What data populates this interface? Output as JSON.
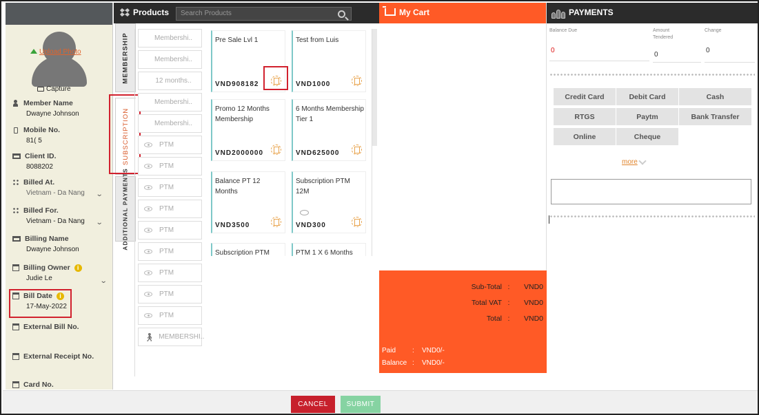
{
  "member": {
    "upload_photo": "Upload Photo",
    "capture": "Capture",
    "member_name_label": "Member Name",
    "member_name": "Dwayne Johnson",
    "mobile_label": "Mobile No.",
    "mobile": "81( 5",
    "client_id_label": "Client ID.",
    "client_id": "8088202",
    "billed_at_label": "Billed At.",
    "billed_at": "Vietnam - Da Nang",
    "billed_for_label": "Billed For.",
    "billed_for": "Vietnam - Da Nang",
    "billing_name_label": "Billing Name",
    "billing_name": "Dwayne  Johnson",
    "billing_owner_label": "Billing Owner",
    "billing_owner": "Judie Le",
    "bill_date_label": "Bill Date",
    "bill_date": "17-May-2022",
    "external_bill_label": "External Bill No.",
    "external_receipt_label": "External Receipt No.",
    "card_no_label": "Card No."
  },
  "products": {
    "title": "Products",
    "search_placeholder": "Search Products",
    "tabs": [
      "MEMBERSHIP",
      "SUBSCRIPTION",
      "ADDITIONAL PAYMENTS"
    ],
    "list": [
      "Membershi..",
      "Membershi..",
      "12 months..",
      "Membershi..",
      "Membershi..",
      "PTM",
      "PTM",
      "PTM",
      "PTM",
      "PTM",
      "PTM",
      "PTM",
      "PTM",
      "PTM",
      "MEMBERSHI.."
    ],
    "cards": [
      {
        "name": "Pre Sale Lvl 1",
        "price": "VND908182"
      },
      {
        "name": "Test from Luis",
        "price": "VND1000"
      },
      {
        "name": "Promo 12 Months Membership",
        "price": "VND2000000"
      },
      {
        "name": "6 Months Membership Tier 1",
        "price": "VND625000"
      },
      {
        "name": "Balance PT 12 Months",
        "price": "VND3500"
      },
      {
        "name": "Subscription PTM 12M",
        "price": "VND300"
      },
      {
        "name": "Subscription PTM",
        "price": ""
      },
      {
        "name": "PTM 1 X 6 Months",
        "price": ""
      }
    ]
  },
  "cart": {
    "title": "My Cart",
    "subtotal_label": "Sub-Total",
    "subtotal": "VND0",
    "vat_label": "Total VAT",
    "vat": "VND0",
    "total_label": "Total",
    "total": "VND0",
    "paid_label": "Paid",
    "paid": "VND0/-",
    "balance_label": "Balance",
    "balance": "VND0/-",
    "sep": ":"
  },
  "payments": {
    "title": "PAYMENTS",
    "balance_due_label": "Balance Due",
    "balance_due": "0",
    "amount_tendered_label": "Amount Tendered",
    "amount_tendered": "0",
    "change_label": "Change",
    "change": "0",
    "methods": [
      "Credit Card",
      "Debit Card",
      "Cash",
      "RTGS",
      "Paytm",
      "Bank Transfer",
      "Online",
      "Cheque"
    ],
    "more": "more"
  },
  "footer": {
    "cancel": "CANCEL",
    "submit": "SUBMIT"
  },
  "colors": {
    "accent": "#ff5a26",
    "cancel": "#c7202c",
    "submit": "#86d3a2"
  }
}
